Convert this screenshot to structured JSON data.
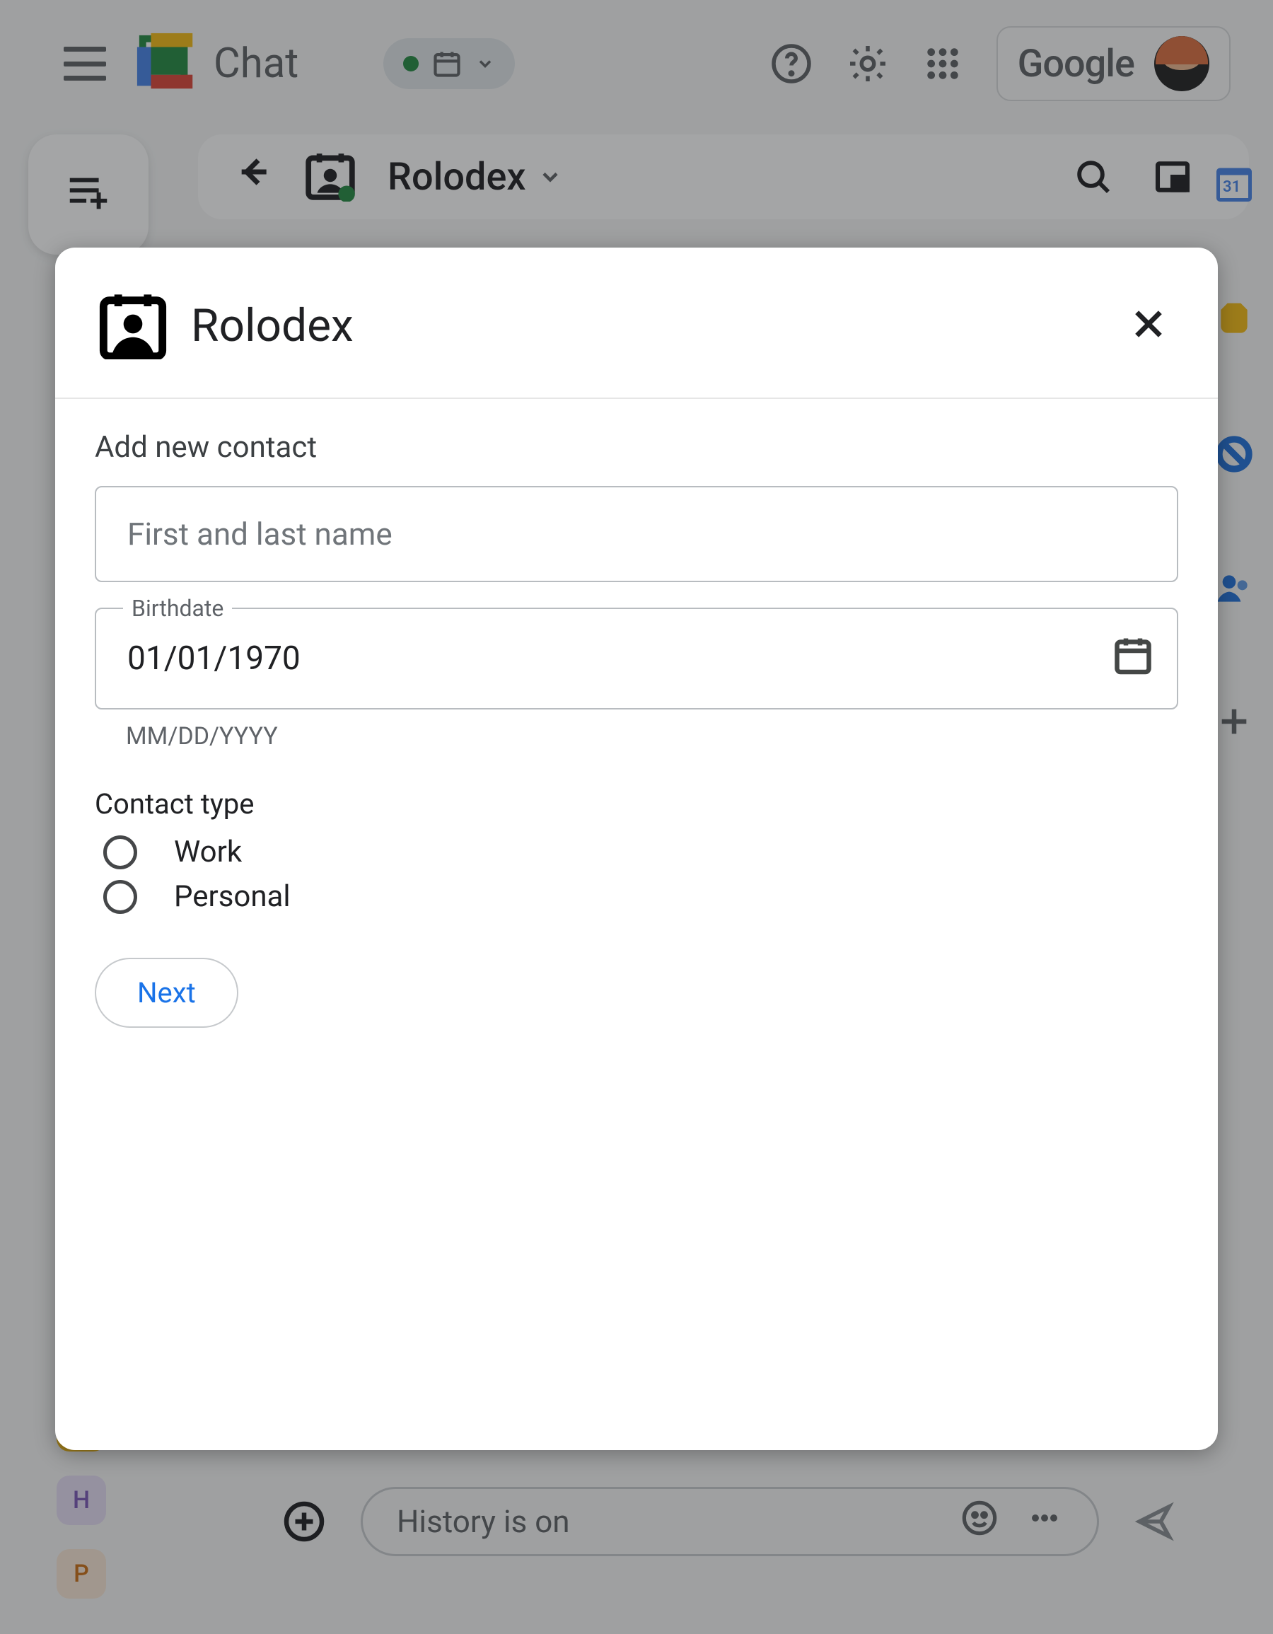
{
  "topbar": {
    "app_label": "Chat",
    "google_label": "Google"
  },
  "space": {
    "title": "Rolodex",
    "calendar_day": "31"
  },
  "compose": {
    "placeholder": "History is on"
  },
  "chips": {
    "h_label": "H",
    "p_label": "P"
  },
  "modal": {
    "title": "Rolodex",
    "add_label": "Add new contact",
    "name_placeholder": "First and last name",
    "birthdate_label": "Birthdate",
    "birthdate_value": "01/01/1970",
    "birthdate_helper": "MM/DD/YYYY",
    "contact_type_label": "Contact type",
    "type_work": "Work",
    "type_personal": "Personal",
    "next_label": "Next"
  }
}
